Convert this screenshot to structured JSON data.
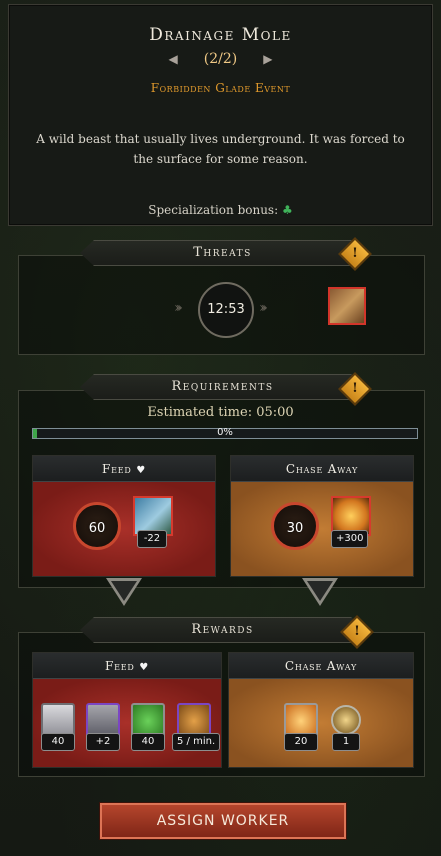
{
  "header": {
    "title": "Drainage Mole",
    "pager": "(2/2)",
    "event": "Forbidden Glade Event",
    "description": "A wild beast that usually lives underground. It was forced to the surface for some reason.",
    "spec_label": "Specialization bonus:"
  },
  "threats": {
    "title": "Threats",
    "timer": "12:53"
  },
  "requirements": {
    "title": "Requirements",
    "estimated": "Estimated time: 05:00",
    "progress_label": "0%",
    "progress_value": 0.01,
    "feed": {
      "title": "Feed",
      "worker_count": "60",
      "resource_delta": "-22"
    },
    "chase": {
      "title": "Chase Away",
      "worker_count": "30",
      "resource_delta": "+300"
    }
  },
  "rewards": {
    "title": "Rewards",
    "feed": {
      "title": "Feed",
      "items": [
        "40",
        "+2",
        "40",
        "5 / min."
      ]
    },
    "chase": {
      "title": "Chase Away",
      "items": [
        "20",
        "1"
      ]
    }
  },
  "assign_button": "ASSIGN WORKER",
  "colors": {
    "accent_orange": "#e19a2c",
    "danger_red": "#d2352a",
    "progress_green": "#3fa44a"
  }
}
